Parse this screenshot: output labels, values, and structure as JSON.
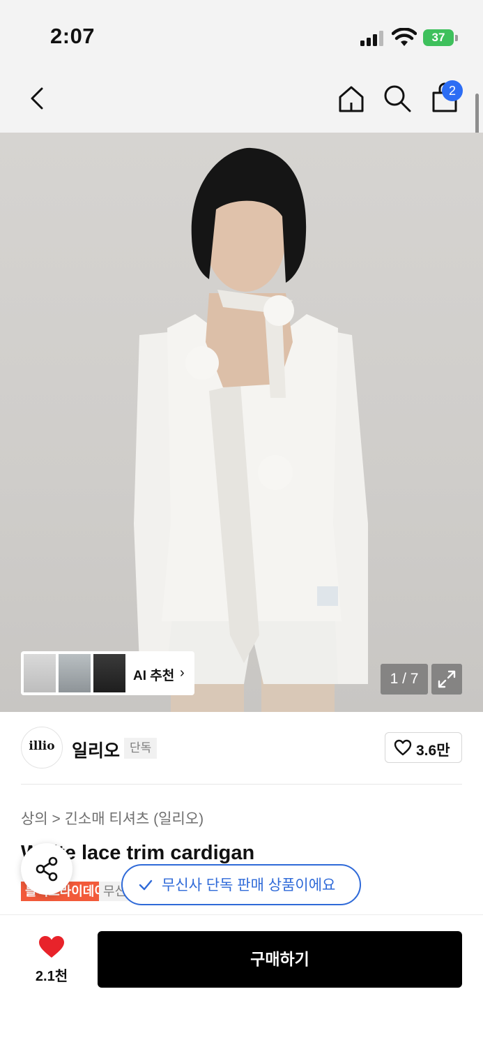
{
  "status_bar": {
    "time": "2:07",
    "battery": "37"
  },
  "header": {
    "cart_count": "2",
    "icons": [
      "back-icon",
      "home-icon",
      "search-icon",
      "cart-icon"
    ]
  },
  "gallery": {
    "page_indicator": "1 / 7",
    "ai_label": "AI 추천",
    "ai_arrow": "›"
  },
  "brand": {
    "logo_text": "illio",
    "name": "일리오",
    "exclusive_badge": "단독"
  },
  "likes": {
    "count": "3.6만"
  },
  "product": {
    "breadcrumb": "상의 > 긴소매 티셔츠 (일리오)",
    "title": "White lace trim cardigan",
    "sale_tag": "블랙프라이데이 특세일",
    "muted_tag": "무신사 단독"
  },
  "toast": {
    "text": "무신사 단독 판매 상품이에요"
  },
  "bottom_bar": {
    "wish_count": "2.1천",
    "buy_label": "구매하기"
  },
  "colors": {
    "accent_blue": "#2f6ad8",
    "sale_red": "#f25a3a",
    "heart_red": "#e8232a"
  }
}
